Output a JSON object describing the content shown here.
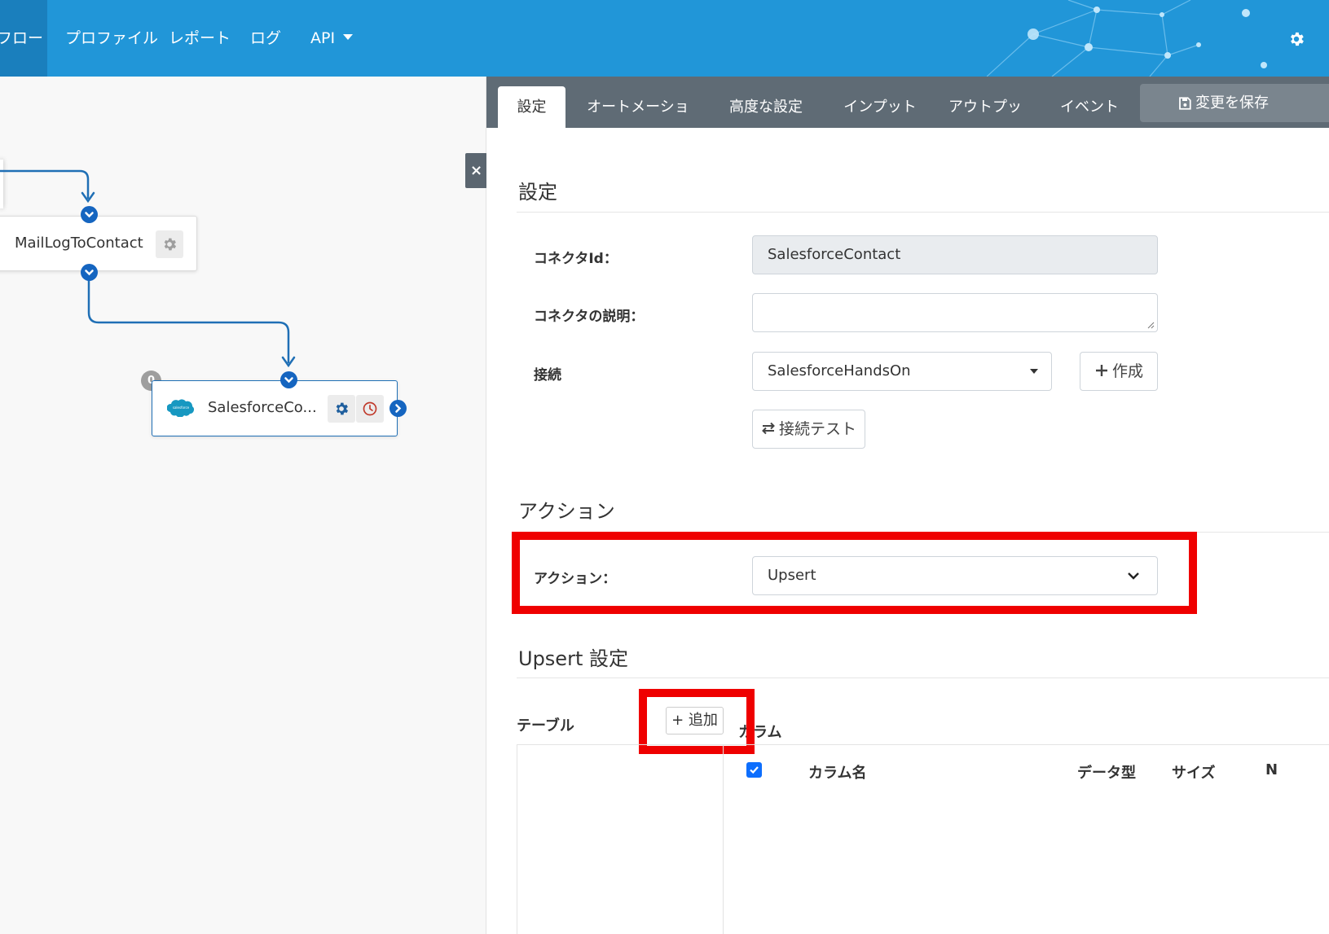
{
  "nav": {
    "items": [
      {
        "label": "フロー",
        "active": true
      },
      {
        "label": "プロファイル"
      },
      {
        "label": "レポート"
      },
      {
        "label": "ログ"
      },
      {
        "label": "API"
      }
    ]
  },
  "canvas": {
    "collapse_label": "×",
    "node1": {
      "label": "MailLogToContact"
    },
    "node2": {
      "label": "SalesforceCo...",
      "badge": "0",
      "logo_text": "salesforce"
    }
  },
  "tabs": [
    "設定",
    "オートメーション",
    "高度な設定",
    "インプット",
    "アウトプット",
    "イベント"
  ],
  "save_label": "変更を保存",
  "settings": {
    "title": "設定",
    "connector_id_label": "コネクタId：",
    "connector_id_value": "SalesforceContact",
    "description_label": "コネクタの説明：",
    "description_value": "",
    "connection_label": "接続",
    "connection_value": "SalesforceHandsOn",
    "create_label": "作成",
    "test_label": "接続テスト"
  },
  "action": {
    "title": "アクション",
    "label": "アクション：",
    "value": "Upsert"
  },
  "upsert": {
    "title": "Upsert 設定",
    "table_label": "テーブル",
    "add_label": "+ 追加",
    "column_label": "カラム",
    "columns": [
      "カラム名",
      "データ型",
      "サイズ",
      "N"
    ]
  },
  "colors": {
    "nav_bg": "#2196d8",
    "tabbar_bg": "#5f6b75",
    "highlight": "#ef0000",
    "port": "#1565c0",
    "edge": "#1f6fb5"
  }
}
